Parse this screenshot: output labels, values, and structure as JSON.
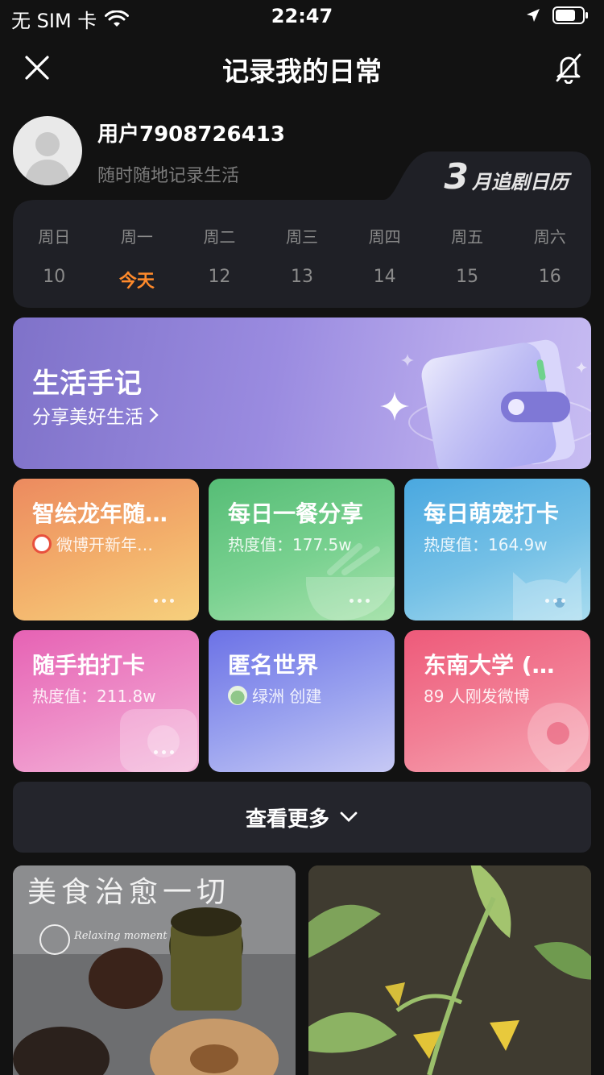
{
  "status_bar": {
    "carrier": "无 SIM 卡",
    "time": "22:47"
  },
  "nav": {
    "title": "记录我的日常"
  },
  "profile": {
    "username": "用户7908726413",
    "subtitle": "随时随地记录生活"
  },
  "calendar": {
    "title_number": "3",
    "title_text": "月追剧日历",
    "days": [
      {
        "weekday": "周日",
        "date": "10",
        "today": false
      },
      {
        "weekday": "周一",
        "date": "今天",
        "today": true
      },
      {
        "weekday": "周二",
        "date": "12",
        "today": false
      },
      {
        "weekday": "周三",
        "date": "13",
        "today": false
      },
      {
        "weekday": "周四",
        "date": "14",
        "today": false
      },
      {
        "weekday": "周五",
        "date": "15",
        "today": false
      },
      {
        "weekday": "周六",
        "date": "16",
        "today": false
      }
    ]
  },
  "banner": {
    "title": "生活手记",
    "subtitle": "分享美好生活"
  },
  "topics": [
    {
      "title": "智绘龙年随…",
      "subtitle": "微博开新年…"
    },
    {
      "title": "每日一餐分享",
      "subtitle": "热度值：177.5w"
    },
    {
      "title": "每日萌宠打卡",
      "subtitle": "热度值：164.9w"
    },
    {
      "title": "随手拍打卡",
      "subtitle": "热度值：211.8w"
    },
    {
      "title": "匿名世界",
      "subtitle": "绿洲 创建"
    },
    {
      "title": "东南大学 (…",
      "subtitle": "89 人刚发微博"
    }
  ],
  "see_more": {
    "label": "查看更多"
  },
  "feed": [
    {
      "overlay_text": "美食治愈一切",
      "logo_text": "Relaxing moment"
    }
  ],
  "colors": {
    "accent_today": "#ff8a2b",
    "background": "#121212",
    "card_bg": "#24252c"
  }
}
